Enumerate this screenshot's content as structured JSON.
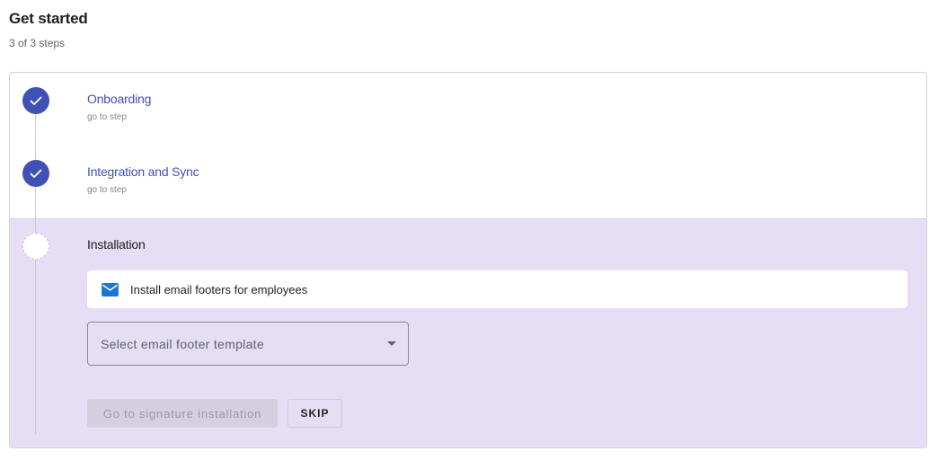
{
  "header": {
    "title": "Get started",
    "subtitle": "3 of 3 steps"
  },
  "steps": [
    {
      "title": "Onboarding",
      "link": "go to step",
      "status": "completed",
      "icon": "check-icon"
    },
    {
      "title": "Integration and Sync",
      "link": "go to step",
      "status": "completed",
      "icon": "check-icon"
    },
    {
      "title": "Installation",
      "status": "current"
    }
  ],
  "installation": {
    "info_label": "Install email footers for employees",
    "info_icon": "mail-icon",
    "select_placeholder": "Select email footer template",
    "go_button": "Go to signature installation",
    "skip_button": "SKIP"
  },
  "colors": {
    "accent": "#3f51b5",
    "active_step_bg": "#e6def5",
    "mail_icon": "#1976d2"
  }
}
